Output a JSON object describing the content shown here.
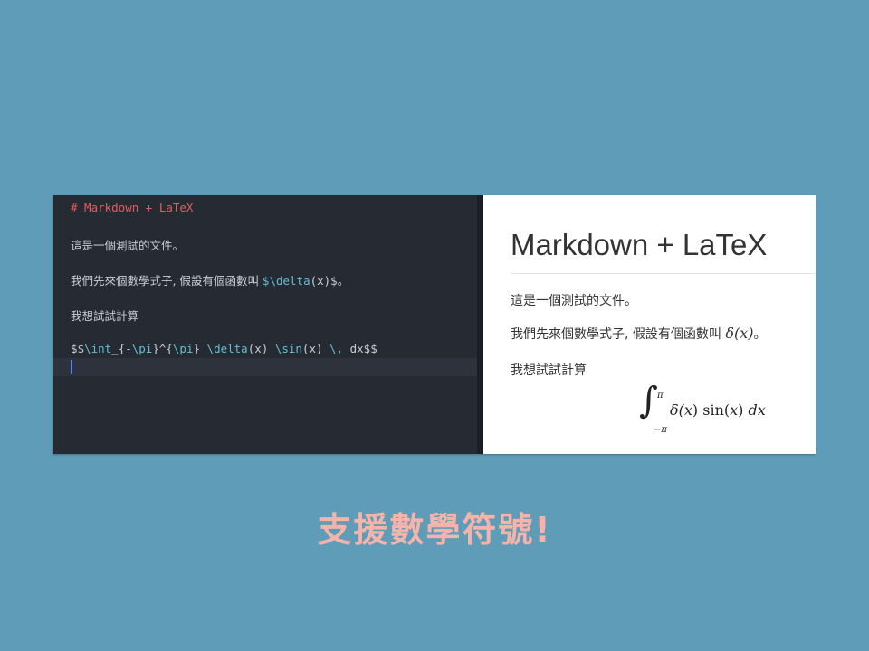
{
  "editor": {
    "heading_line": "# Markdown + LaTeX",
    "line_intro": "這是一個測試的文件。",
    "line_func_prefix": "我們先來個數學式子, 假設有個函數叫 ",
    "line_func_cmd": "$\\delta",
    "line_func_arg": "(x)$",
    "line_func_suffix": "。",
    "line_try": "我想試試計算",
    "tex": {
      "open": "$$",
      "int": "\\int",
      "lower": "_{-",
      "pi1": "\\pi",
      "upper": "}^{",
      "pi2": "\\pi",
      "close_brace": "} ",
      "delta": "\\delta",
      "delta_arg": "(x) ",
      "sin": "\\sin",
      "sin_arg": "(x) ",
      "space": "\\,",
      "end": " dx$$"
    }
  },
  "preview": {
    "title": "Markdown + LaTeX",
    "para1": "這是一個測試的文件。",
    "para2_prefix": "我們先來個數學式子, 假設有個函數叫 ",
    "para2_math": "δ(x)",
    "para2_suffix": "。",
    "para3": "我想試試計算",
    "math": {
      "integral": "∫",
      "upper": "π",
      "lower": "−π",
      "body_delta": "δ(",
      "body_x1": "x",
      "body_mid": ") sin(",
      "body_x2": "x",
      "body_end": ") ",
      "body_dx": "dx"
    }
  },
  "caption": "支援數學符號!",
  "colors": {
    "background": "#5e9cb7",
    "editor_bg": "#262a33",
    "heading": "#e35d5d",
    "tex_command": "#5fc1d3",
    "caption": "#f4b3ab"
  }
}
